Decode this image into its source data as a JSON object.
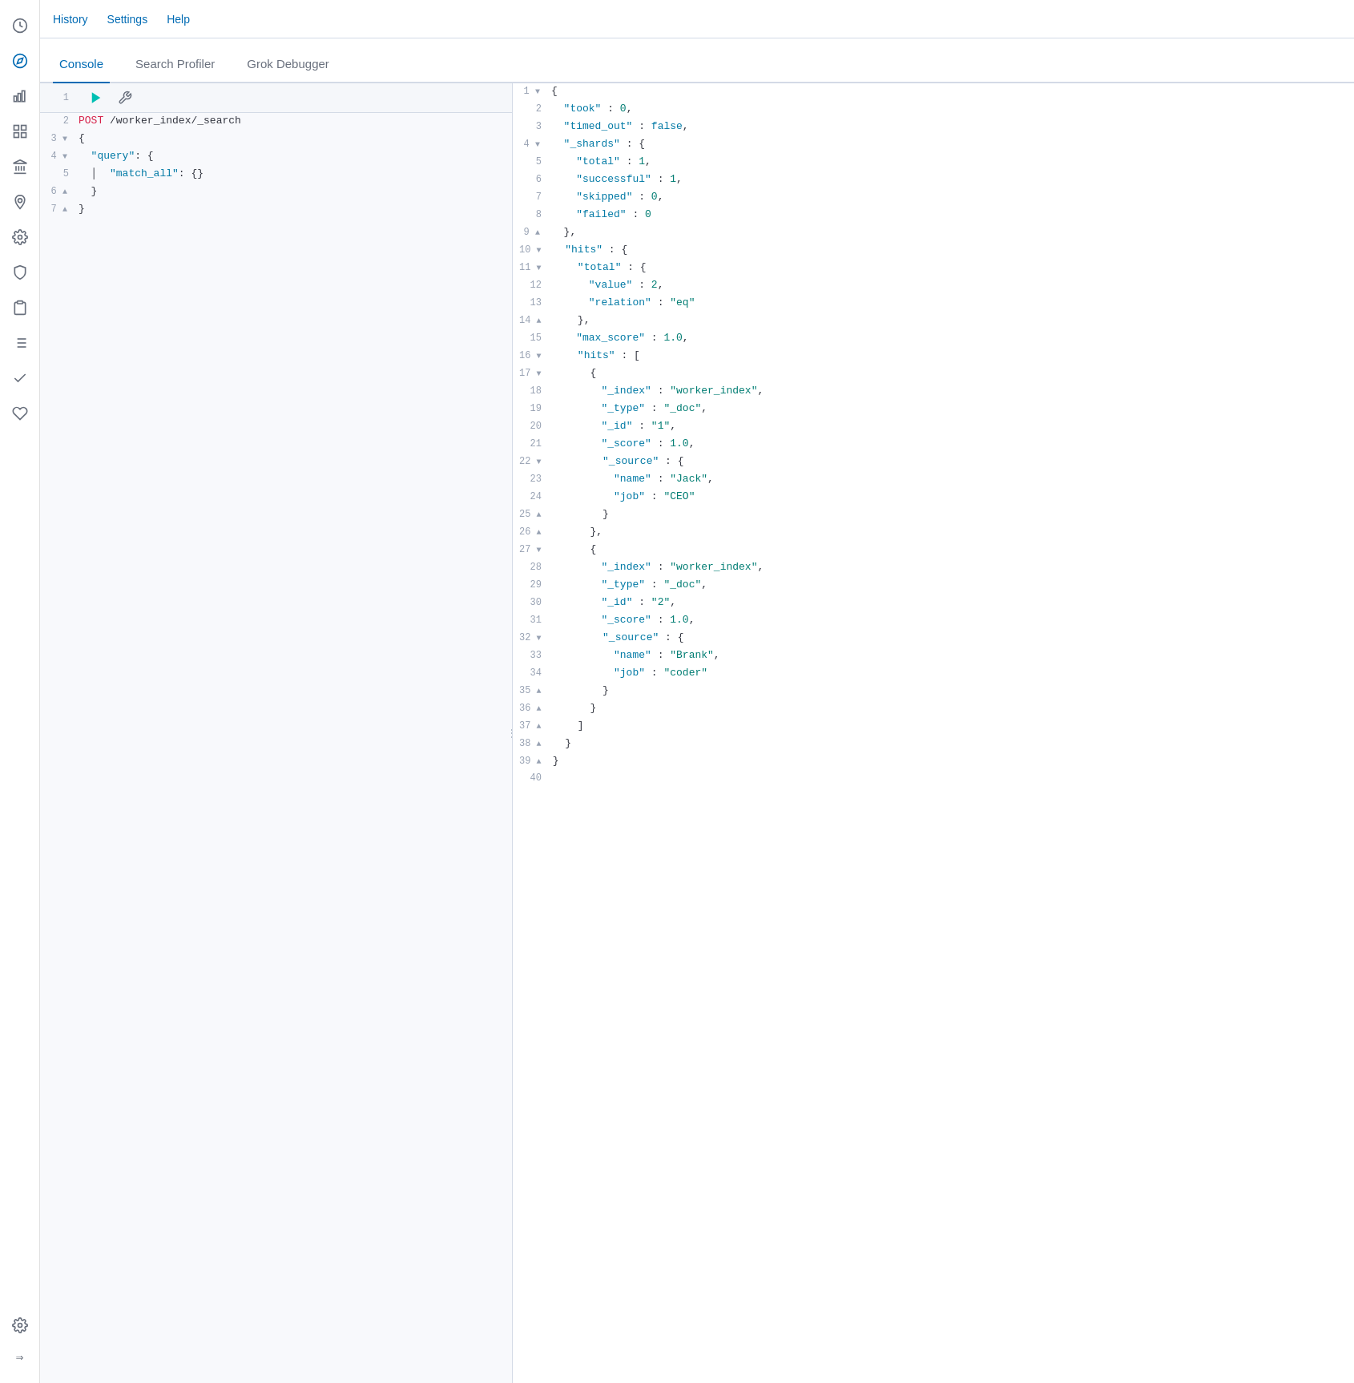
{
  "topnav": {
    "items": [
      "History",
      "Settings",
      "Help"
    ]
  },
  "tabs": {
    "items": [
      "Console",
      "Search Profiler",
      "Grok Debugger"
    ],
    "active": 0
  },
  "sidebar": {
    "icons": [
      {
        "name": "clock-icon",
        "glyph": "🕐"
      },
      {
        "name": "compass-icon",
        "glyph": "⊙"
      },
      {
        "name": "chart-icon",
        "glyph": "📊"
      },
      {
        "name": "table-icon",
        "glyph": "▦"
      },
      {
        "name": "building-icon",
        "glyph": "🏛"
      },
      {
        "name": "location-icon",
        "glyph": "◎"
      },
      {
        "name": "cluster-icon",
        "glyph": "⚙"
      },
      {
        "name": "security-icon",
        "glyph": "🔒"
      },
      {
        "name": "notes-icon",
        "glyph": "📋"
      },
      {
        "name": "index-icon",
        "glyph": "▤"
      },
      {
        "name": "check-icon",
        "glyph": "✔"
      },
      {
        "name": "monitoring-icon",
        "glyph": "♡"
      },
      {
        "name": "settings-icon",
        "glyph": "⚙"
      },
      {
        "name": "arrow-icon",
        "glyph": "⇒"
      }
    ]
  },
  "left_editor": {
    "lines": [
      {
        "num": "1",
        "fold": false,
        "content": "",
        "parts": []
      },
      {
        "num": "2",
        "fold": false,
        "content": "POST /worker_index/_search",
        "method": "POST",
        "path": "/worker_index/_search"
      },
      {
        "num": "3",
        "fold": true,
        "content": "{"
      },
      {
        "num": "4",
        "fold": true,
        "content": "  \"query\": {"
      },
      {
        "num": "5",
        "fold": false,
        "content": "  |  \"match_all\": {}"
      },
      {
        "num": "6",
        "fold": true,
        "content": "  }"
      },
      {
        "num": "7",
        "fold": true,
        "content": "}"
      }
    ]
  },
  "right_editor": {
    "lines": [
      {
        "num": "1",
        "fold": true,
        "content": "{"
      },
      {
        "num": "2",
        "content": "  \"took\" : 0,"
      },
      {
        "num": "3",
        "content": "  \"timed_out\" : false,"
      },
      {
        "num": "4",
        "fold": true,
        "content": "  \"_shards\" : {"
      },
      {
        "num": "5",
        "content": "    \"total\" : 1,"
      },
      {
        "num": "6",
        "content": "    \"successful\" : 1,"
      },
      {
        "num": "7",
        "content": "    \"skipped\" : 0,"
      },
      {
        "num": "8",
        "content": "    \"failed\" : 0"
      },
      {
        "num": "9",
        "fold": true,
        "content": "  },"
      },
      {
        "num": "10",
        "fold": true,
        "content": "  \"hits\" : {"
      },
      {
        "num": "11",
        "fold": true,
        "content": "    \"total\" : {"
      },
      {
        "num": "12",
        "content": "      \"value\" : 2,"
      },
      {
        "num": "13",
        "content": "      \"relation\" : \"eq\""
      },
      {
        "num": "14",
        "fold": true,
        "content": "    },"
      },
      {
        "num": "15",
        "content": "    \"max_score\" : 1.0,"
      },
      {
        "num": "16",
        "fold": true,
        "content": "    \"hits\" : ["
      },
      {
        "num": "17",
        "fold": true,
        "content": "      {"
      },
      {
        "num": "18",
        "content": "        \"_index\" : \"worker_index\","
      },
      {
        "num": "19",
        "content": "        \"_type\" : \"_doc\","
      },
      {
        "num": "20",
        "content": "        \"_id\" : \"1\","
      },
      {
        "num": "21",
        "content": "        \"_score\" : 1.0,"
      },
      {
        "num": "22",
        "fold": true,
        "content": "        \"_source\" : {"
      },
      {
        "num": "23",
        "content": "          \"name\" : \"Jack\","
      },
      {
        "num": "24",
        "content": "          \"job\" : \"CEO\""
      },
      {
        "num": "25",
        "fold": true,
        "content": "        }"
      },
      {
        "num": "26",
        "fold": true,
        "content": "      },"
      },
      {
        "num": "27",
        "fold": true,
        "content": "      {"
      },
      {
        "num": "28",
        "content": "        \"_index\" : \"worker_index\","
      },
      {
        "num": "29",
        "content": "        \"_type\" : \"_doc\","
      },
      {
        "num": "30",
        "content": "        \"_id\" : \"2\","
      },
      {
        "num": "31",
        "content": "        \"_score\" : 1.0,"
      },
      {
        "num": "32",
        "fold": true,
        "content": "        \"_source\" : {"
      },
      {
        "num": "33",
        "content": "          \"name\" : \"Brank\","
      },
      {
        "num": "34",
        "content": "          \"job\" : \"coder\""
      },
      {
        "num": "35",
        "fold": true,
        "content": "        }"
      },
      {
        "num": "36",
        "fold": true,
        "content": "      }"
      },
      {
        "num": "37",
        "fold": true,
        "content": "    ]"
      },
      {
        "num": "38",
        "fold": true,
        "content": "  }"
      },
      {
        "num": "39",
        "fold": true,
        "content": "}"
      },
      {
        "num": "40",
        "content": ""
      }
    ]
  }
}
